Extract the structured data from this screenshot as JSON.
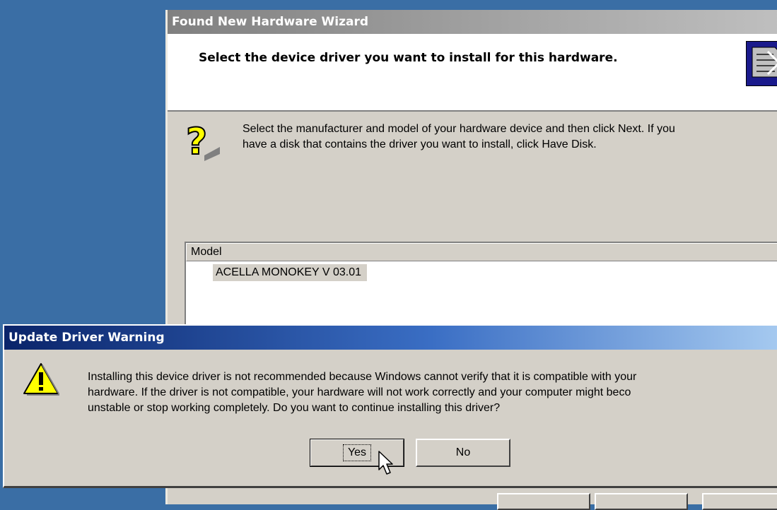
{
  "wizard": {
    "title": "Found New Hardware Wizard",
    "header_title": "Select the device driver you want to install for this hardware.",
    "instruction_line1": "Select the manufacturer and model of your hardware device and then click Next. If you",
    "instruction_line2": "have a disk that contains the driver you want to install, click Have Disk.",
    "model_header": "Model",
    "models": [
      "ACELLA MONOKEY V 03.01"
    ]
  },
  "warning_dialog": {
    "title": "Update Driver Warning",
    "message_lines": [
      "Installing this device driver is not recommended because Windows cannot verify that it is compatible with your",
      "hardware.  If the driver is not compatible, your hardware will not work correctly and your computer might beco",
      "unstable or stop working completely.  Do you want to continue installing this driver?"
    ],
    "yes_label": "Yes",
    "no_label": "No"
  },
  "icons": {
    "help": "question-mark-help-icon",
    "warning": "warning-triangle-icon",
    "header": "hardware-wizard-icon",
    "cursor": "mouse-pointer-icon"
  },
  "colors": {
    "desktop": "#3a6ea5",
    "dialog_face": "#d4d0c8",
    "active_title_start": "#0a246a",
    "active_title_end": "#a6caf0",
    "inactive_title": "#808080"
  }
}
